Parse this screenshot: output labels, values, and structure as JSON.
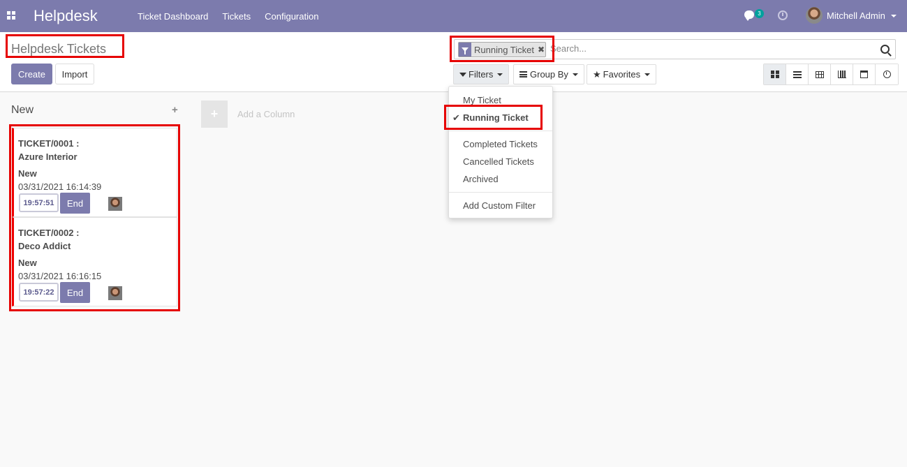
{
  "navbar": {
    "brand": "Helpdesk",
    "menu": [
      "Ticket Dashboard",
      "Tickets",
      "Configuration"
    ],
    "chat_count": "3",
    "user_name": "Mitchell Admin"
  },
  "control_panel": {
    "title": "Helpdesk Tickets",
    "create_label": "Create",
    "import_label": "Import",
    "search": {
      "facet_label": "Running Ticket",
      "facet_close": "✖",
      "placeholder": "Search..."
    },
    "filters_label": "Filters",
    "groupby_label": "Group By",
    "favorites_label": "Favorites",
    "views": [
      "kanban",
      "list",
      "pivot",
      "graph",
      "calendar",
      "activity"
    ]
  },
  "filter_menu": {
    "items": [
      {
        "label": "My Ticket",
        "checked": false
      },
      {
        "label": "Running Ticket",
        "checked": true
      },
      {
        "label": "Completed Tickets",
        "checked": false
      },
      {
        "label": "Cancelled Tickets",
        "checked": false
      },
      {
        "label": "Archived",
        "checked": false
      },
      {
        "label": "Add Custom Filter",
        "checked": false
      }
    ]
  },
  "kanban": {
    "column_title": "New",
    "add_column_label": "Add a Column",
    "end_label": "End",
    "cards": [
      {
        "ref": "TICKET/0001 :",
        "partner": "Azure Interior",
        "stage": "New",
        "date": "03/31/2021 16:14:39",
        "timer": "19:57:51"
      },
      {
        "ref": "TICKET/0002 :",
        "partner": "Deco Addict",
        "stage": "New",
        "date": "03/31/2021 16:16:15",
        "timer": "19:57:22"
      }
    ]
  },
  "colors": {
    "brand": "#7c7bad",
    "highlight": "#e60000",
    "badge": "#00a09d"
  }
}
